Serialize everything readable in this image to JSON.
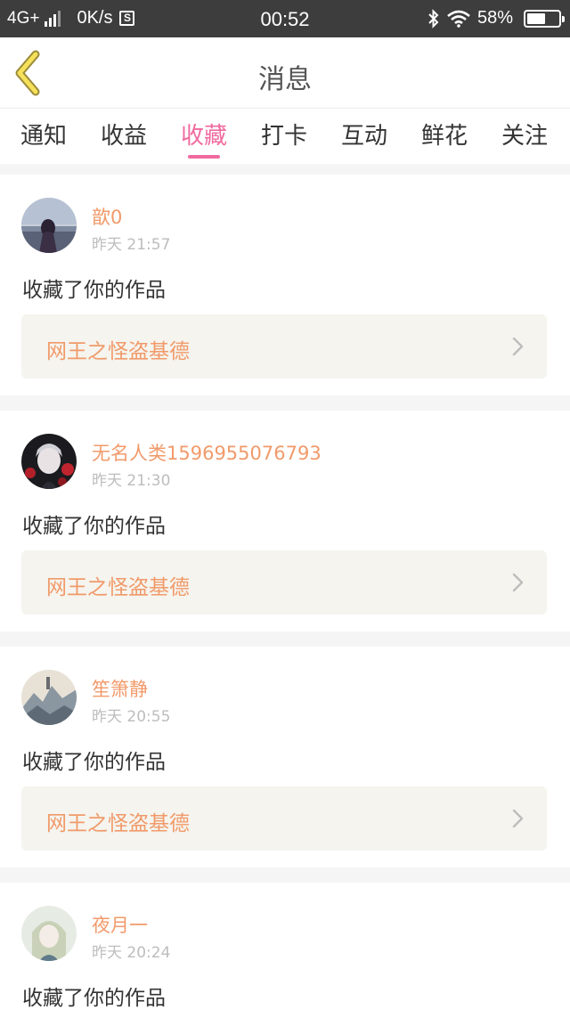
{
  "status_bar": {
    "network": "4G+",
    "speed": "0K/s",
    "s_icon": "S",
    "time": "00:52",
    "battery": "58%",
    "battery_level": 0.58
  },
  "header": {
    "title": "消息"
  },
  "tabs": [
    {
      "label": "通知",
      "active": false
    },
    {
      "label": "收益",
      "active": false
    },
    {
      "label": "收藏",
      "active": true
    },
    {
      "label": "打卡",
      "active": false
    },
    {
      "label": "互动",
      "active": false
    },
    {
      "label": "鲜花",
      "active": false
    },
    {
      "label": "关注",
      "active": false
    }
  ],
  "colors": {
    "accent": "#f06aa0",
    "name_orange": "#f19a6a",
    "status_bar": "#3d3d3d"
  },
  "messages": [
    {
      "user": "歆0",
      "time": "昨天 21:57",
      "action": "收藏了你的作品",
      "work": "网王之怪盗基德"
    },
    {
      "user": "无名人类1596955076793",
      "time": "昨天 21:30",
      "action": "收藏了你的作品",
      "work": "网王之怪盗基德"
    },
    {
      "user": "笙箫静",
      "time": "昨天 20:55",
      "action": "收藏了你的作品",
      "work": "网王之怪盗基德"
    },
    {
      "user": "夜月一",
      "time": "昨天 20:24",
      "action": "收藏了你的作品"
    }
  ]
}
